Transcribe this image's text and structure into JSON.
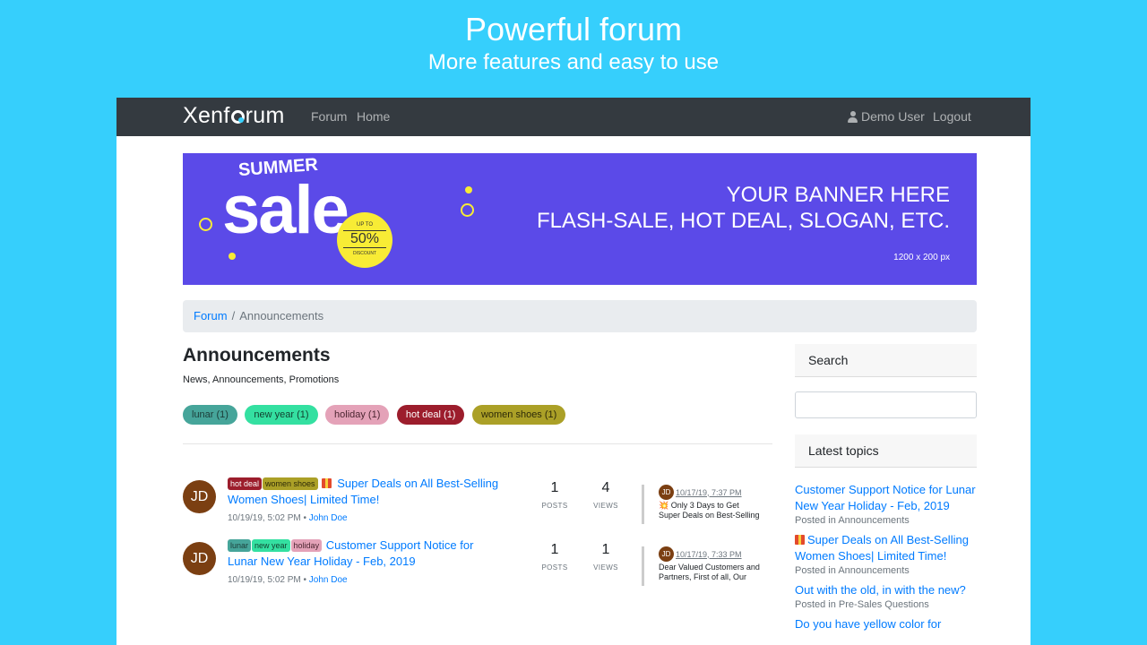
{
  "hero": {
    "title": "Powerful forum",
    "subtitle": "More features and easy to use"
  },
  "navbar": {
    "logo": "Xenforum",
    "links": [
      "Forum",
      "Home"
    ],
    "user": "Demo User",
    "logout": "Logout"
  },
  "banner": {
    "summer": "SUMMER",
    "sale": "sale",
    "upto": "UP TO",
    "percent": "50%",
    "discount": "DISCOUNT",
    "line1": "YOUR BANNER HERE",
    "line2": "FLASH-SALE, HOT DEAL, SLOGAN, ETC.",
    "size": "1200 x 200 px"
  },
  "breadcrumb": {
    "root": "Forum",
    "sep": "/",
    "current": "Announcements"
  },
  "forum": {
    "title": "Announcements",
    "description": "News, Announcements, Promotions",
    "tags": [
      {
        "label": "lunar (1)",
        "bg": "#46a59a",
        "fg": "#1b3b37"
      },
      {
        "label": "new year (1)",
        "bg": "#34e0a1",
        "fg": "#123f2e"
      },
      {
        "label": "holiday (1)",
        "bg": "#e4a2b8",
        "fg": "#4b2530"
      },
      {
        "label": "hot deal (1)",
        "bg": "#9c1d2c",
        "fg": "#ffffff"
      },
      {
        "label": "women shoes (1)",
        "bg": "#aba027",
        "fg": "#2d2a08"
      }
    ]
  },
  "topics": [
    {
      "tags": [
        "hot deal",
        "women shoes"
      ],
      "title_line1": "Super Deals on All Best-Selling",
      "title_line2": "Women Shoes| Limited Time!",
      "date": "10/19/19, 5:02 PM",
      "author": "John Doe",
      "avatar": "JD",
      "posts": "1",
      "views": "4",
      "posts_label": "POSTS",
      "views_label": "VIEWS",
      "last_date": "10/17/19, 7:37 PM",
      "last_snippet1": "💥 Only 3 Days to Get",
      "last_snippet2": "Super Deals on Best-Selling"
    },
    {
      "tags": [
        "lunar",
        "new year",
        "holiday"
      ],
      "title_line1": "Customer Support Notice for",
      "title_line2": "Lunar New Year Holiday - Feb, 2019",
      "date": "10/19/19, 5:02 PM",
      "author": "John Doe",
      "avatar": "JD",
      "posts": "1",
      "views": "1",
      "posts_label": "POSTS",
      "views_label": "VIEWS",
      "last_date": "10/17/19, 7:33 PM",
      "last_snippet1": "Dear Valued Customers and",
      "last_snippet2": "Partners, First of all, Our"
    }
  ],
  "sidebar": {
    "search_title": "Search",
    "latest_title": "Latest topics",
    "latest": [
      {
        "title": "Customer Support Notice for Lunar New Year Holiday - Feb, 2019",
        "meta": "Posted in Announcements"
      },
      {
        "title": "Super Deals on All Best-Selling Women Shoes| Limited Time!",
        "meta": "Posted in Announcements"
      },
      {
        "title": "Out with the old, in with the new?",
        "meta": "Posted in Pre-Sales Questions"
      },
      {
        "title": "Do you have yellow color for",
        "meta": ""
      }
    ]
  },
  "colors": {
    "page_bg": "#36cffc",
    "navbar": "#343a40",
    "banner": "#5b4ae8",
    "link": "#007bff",
    "avatar": "#7b3f12"
  }
}
